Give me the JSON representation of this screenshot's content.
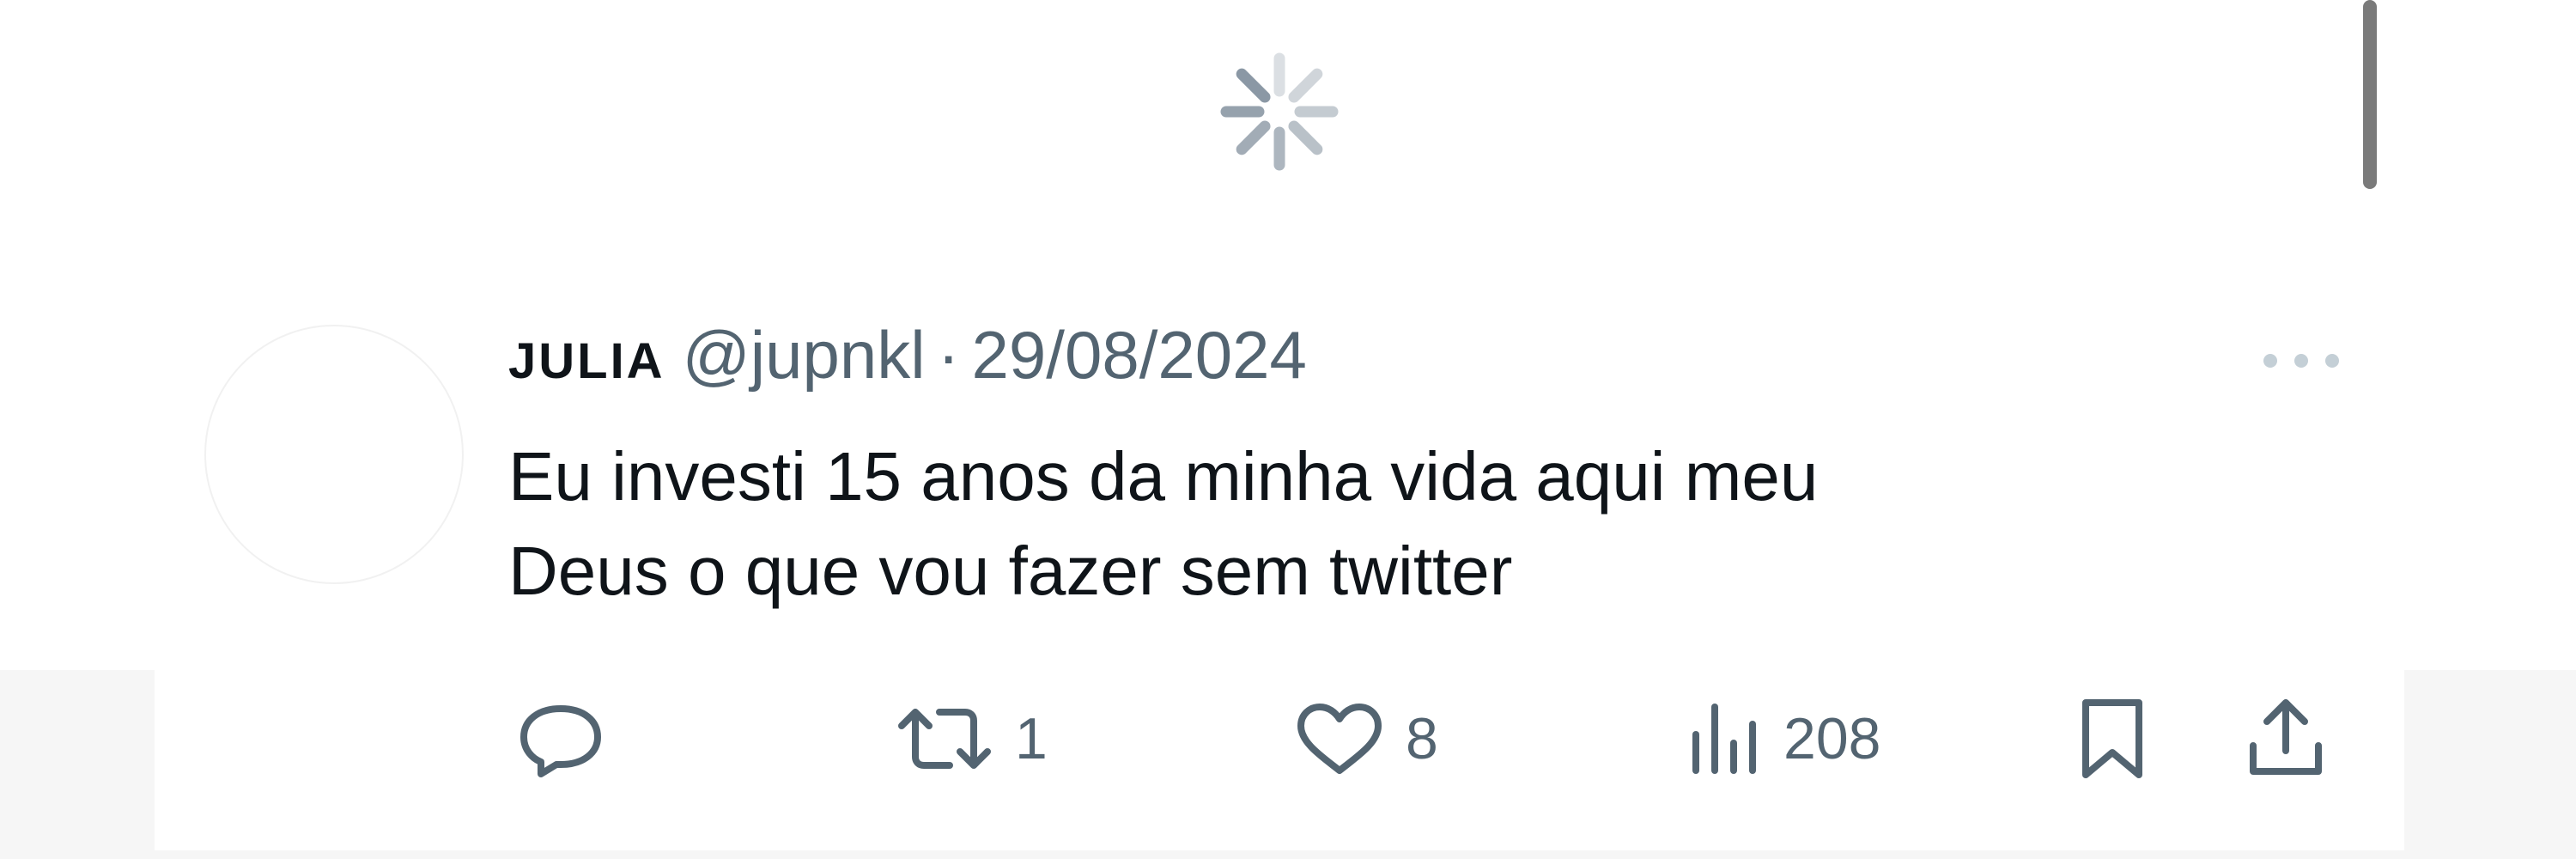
{
  "loading": {
    "spinner_icon": "loading-spinner-icon"
  },
  "tweet": {
    "author": {
      "display_name": "JULIA",
      "handle": "@jupnkl"
    },
    "separator": "·",
    "date": "29/08/2024",
    "text_lines": [
      "Eu investi 15 anos da minha vida aqui meu",
      "Deus o que vou fazer sem twitter"
    ],
    "actions": {
      "reply": {
        "icon": "reply-icon"
      },
      "retweet": {
        "icon": "retweet-icon",
        "count": "1"
      },
      "like": {
        "icon": "heart-icon",
        "count": "8"
      },
      "views": {
        "icon": "analytics-icon",
        "count": "208"
      },
      "bookmark": {
        "icon": "bookmark-icon"
      },
      "share": {
        "icon": "share-icon"
      }
    },
    "more_icon": "more-options-icon"
  },
  "colors": {
    "text_primary": "#0f1419",
    "text_secondary": "#536471",
    "spinner": "#8b98a5",
    "scrollbar": "#7a7a7a"
  }
}
